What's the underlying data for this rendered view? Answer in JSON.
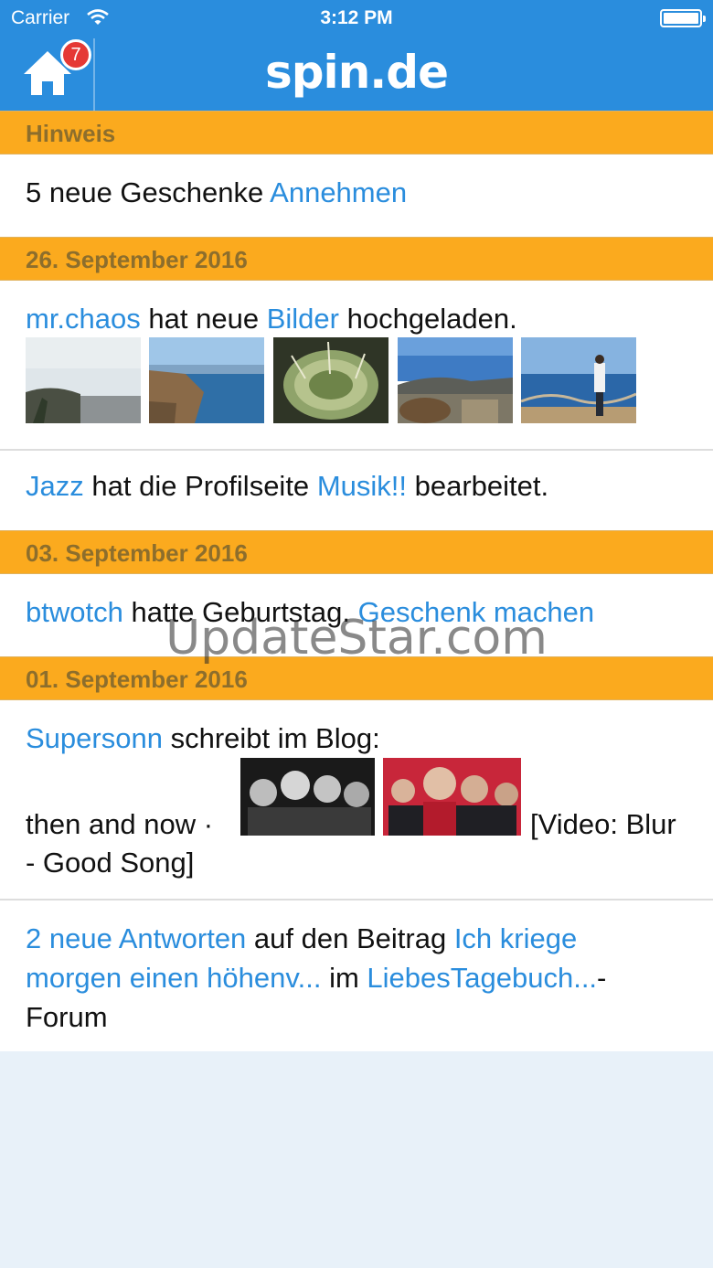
{
  "status_bar": {
    "carrier": "Carrier",
    "time": "3:12 PM"
  },
  "header": {
    "logo": "spin.de",
    "badge": "7"
  },
  "hinweis": {
    "title": "Hinweis",
    "text": "5 neue Geschenke",
    "link": "Annehmen"
  },
  "sections": [
    {
      "date": "26. September 2016"
    },
    {
      "date": "03. September 2016"
    },
    {
      "date": "01. September 2016"
    }
  ],
  "feed": {
    "mrchaos": {
      "user": "mr.chaos",
      "t1": "hat neue",
      "link": "Bilder",
      "t2": "hochgeladen."
    },
    "jazz": {
      "user": "Jazz",
      "t1": "hat die Profilseite",
      "link": "Musik!!",
      "t2": "bearbeitet."
    },
    "btwotch": {
      "user": "btwotch",
      "t1": "hatte Geburtstag.",
      "link": "Geschenk machen"
    },
    "blog": {
      "user": "Supersonn",
      "t1": "schreibt im Blog:",
      "t2": "then and now ·",
      "t3": "[Video: Blur",
      "t4": "- Good Song]"
    },
    "forum": {
      "link1": "2 neue Antworten",
      "t1": "auf den Beitrag",
      "link2a": "Ich kriege",
      "link2b": "morgen einen höhenv...",
      "t2": "im",
      "link3": "LiebesTagebuch...",
      "t3": "-",
      "t4": "Forum"
    }
  },
  "watermark": "UpdateStar.com",
  "colors": {
    "header_blue": "#2a8ddd",
    "section_orange": "#fbaa1e",
    "link_blue": "#2a8ddd"
  }
}
